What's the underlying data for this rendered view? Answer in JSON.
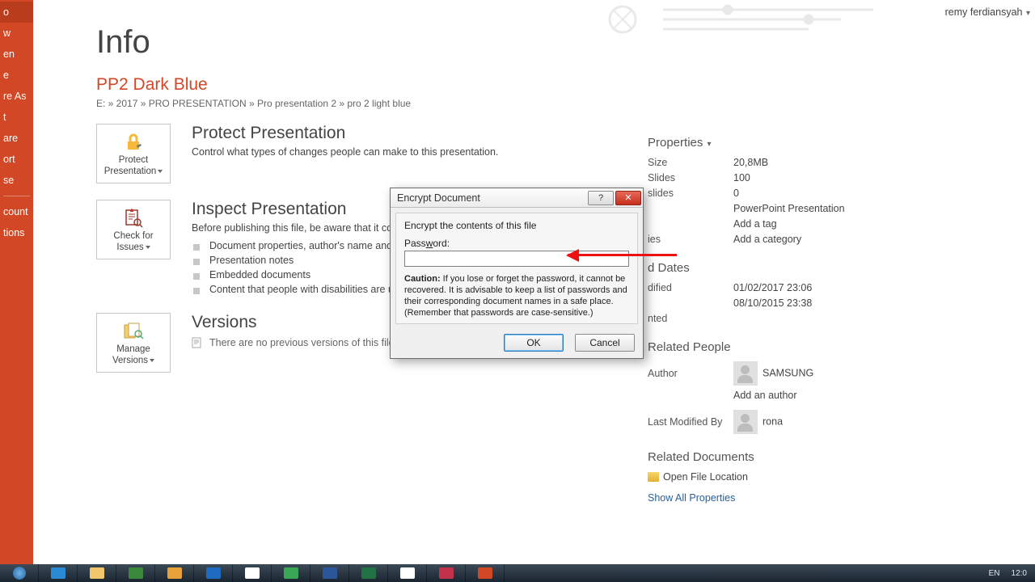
{
  "user": "remy ferdiansyah",
  "sidebar": {
    "items": [
      "o",
      "w",
      "en",
      "e",
      "re As",
      "t",
      "are",
      "ort",
      "se"
    ],
    "bottom": [
      "count",
      "tions"
    ]
  },
  "page": {
    "heading": "Info",
    "doc_title": "PP2 Dark Blue",
    "breadcrumb": "E: » 2017 » PRO PRESENTATION » Pro presentation 2 » pro 2 light blue"
  },
  "protect": {
    "btn_line1": "Protect",
    "btn_line2": "Presentation",
    "title": "Protect Presentation",
    "desc": "Control what types of changes people can make to this presentation."
  },
  "inspect": {
    "btn_line1": "Check for",
    "btn_line2": "Issues",
    "title": "Inspect Presentation",
    "desc_prefix": "Before publishing this file, be aware that it co",
    "bullets": [
      "Document properties, author's name and",
      "Presentation notes",
      "Embedded documents",
      "Content that people with disabilities are u"
    ]
  },
  "versions": {
    "btn_line1": "Manage",
    "btn_line2": "Versions",
    "title": "Versions",
    "desc": "There are no previous versions of this file."
  },
  "props": {
    "header": "Properties",
    "size_k": "Size",
    "size_v": "20,8MB",
    "slides_k": "Slides",
    "slides_v": "100",
    "hslides_k": "slides",
    "hslides_v": "0",
    "pptpres": "PowerPoint Presentation",
    "add_tag": "Add a tag",
    "add_cat": "Add a category",
    "ies": "ies",
    "dates_hdr": "d Dates",
    "mod_k": "dified",
    "mod_v": "01/02/2017 23:06",
    "created_v": "08/10/2015 23:38",
    "printed_k": "nted",
    "people_hdr": "Related People",
    "author_k": "Author",
    "author_v": "SAMSUNG",
    "add_author": "Add an author",
    "lmod_k": "Last Modified By",
    "lmod_v": "rona",
    "docs_hdr": "Related Documents",
    "open_loc": "Open File Location",
    "show_all": "Show All Properties"
  },
  "dialog": {
    "title": "Encrypt Document",
    "lead": "Encrypt the contents of this file",
    "pw_label_pre": "Pass",
    "pw_label_u": "w",
    "pw_label_post": "ord:",
    "caution1": "Caution: If you lose or forget the password, it cannot be recovered. It is advisable to keep a list of passwords and their corresponding document names in a safe place.",
    "caution2": "(Remember that passwords are case-sensitive.)",
    "ok": "OK",
    "cancel": "Cancel"
  },
  "taskbar": {
    "lang": "EN",
    "time": "12:0"
  }
}
